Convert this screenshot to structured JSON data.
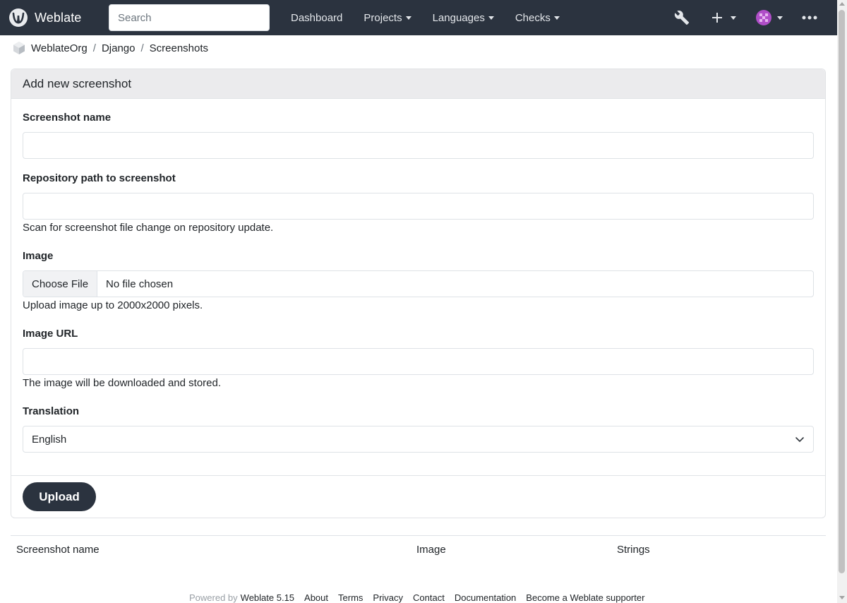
{
  "navbar": {
    "brand": "Weblate",
    "search_placeholder": "Search",
    "links": [
      {
        "label": "Dashboard"
      },
      {
        "label": "Projects"
      },
      {
        "label": "Languages"
      },
      {
        "label": "Checks"
      }
    ],
    "icons": [
      "weblate-logo-icon",
      "wrench-icon",
      "plus-icon",
      "avatar-icon",
      "more-icon"
    ]
  },
  "breadcrumb": {
    "items": [
      "WeblateOrg",
      "Django",
      "Screenshots"
    ],
    "separator": "/"
  },
  "form": {
    "title": "Add new screenshot",
    "name_label": "Screenshot name",
    "name_value": "",
    "repo_label": "Repository path to screenshot",
    "repo_value": "",
    "repo_help": "Scan for screenshot file change on repository update.",
    "image_label": "Image",
    "choose_file": "Choose File",
    "no_file": "No file chosen",
    "image_help": "Upload image up to 2000x2000 pixels.",
    "url_label": "Image URL",
    "url_value": "",
    "url_help": "The image will be downloaded and stored.",
    "translation_label": "Translation",
    "translation_value": "English",
    "upload": "Upload"
  },
  "table": {
    "headers": [
      "Screenshot name",
      "Image",
      "Strings"
    ]
  },
  "footer": {
    "powered_by": "Powered by",
    "version": "Weblate 5.15",
    "links": [
      "About",
      "Terms",
      "Privacy",
      "Contact",
      "Documentation",
      "Become a Weblate supporter"
    ]
  },
  "colors": {
    "navbar": "#2b333f",
    "card_header": "#ebebed",
    "button": "#2b333f",
    "avatar": "#b04ec8"
  }
}
